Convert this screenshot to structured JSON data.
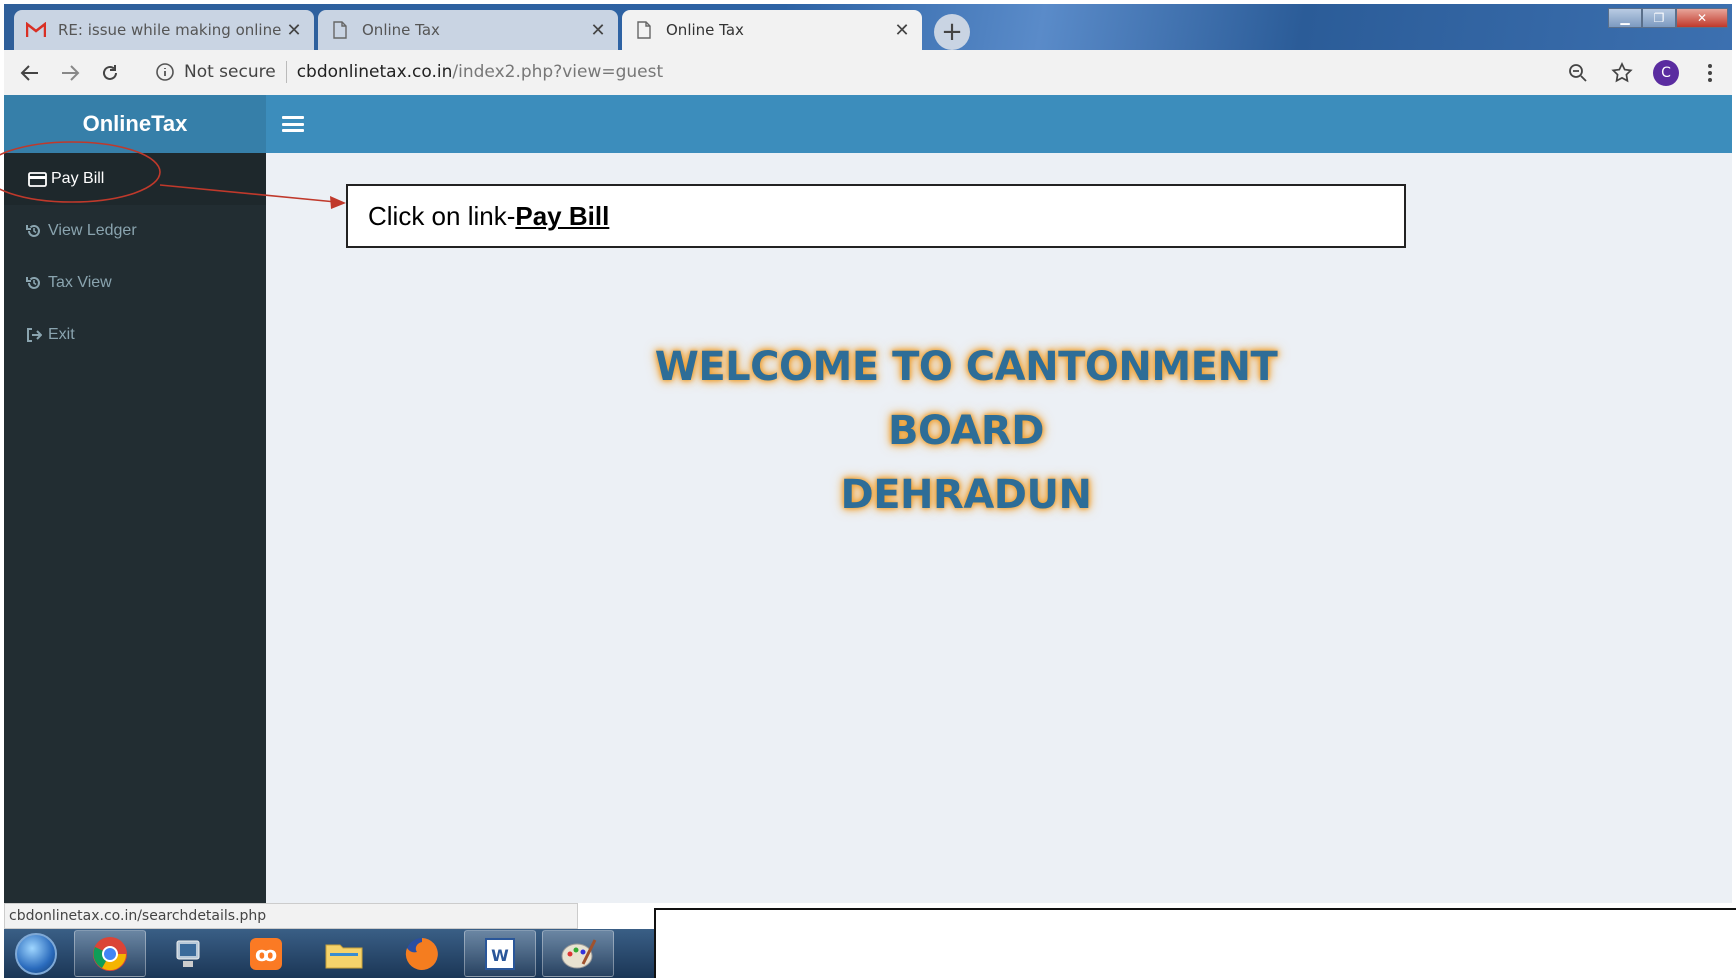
{
  "browser": {
    "tabs": [
      {
        "title": "RE: issue while making online pay",
        "icon": "gmail-icon",
        "active": false
      },
      {
        "title": "Online Tax",
        "icon": "page-icon",
        "active": false
      },
      {
        "title": "Online Tax",
        "icon": "page-icon",
        "active": true
      }
    ],
    "security_label": "Not secure",
    "url_host": "cbdonlinetax.co.in",
    "url_path": "/index2.php?view=guest",
    "profile_initial": "C"
  },
  "app": {
    "logo": "OnlineTax",
    "sidebar": {
      "items": [
        {
          "label": "Pay Bill",
          "icon": "credit-card-icon",
          "active": true
        },
        {
          "label": "View Ledger",
          "icon": "history-icon",
          "active": false
        },
        {
          "label": "Tax View",
          "icon": "history-icon",
          "active": false
        },
        {
          "label": "Exit",
          "icon": "sign-out-icon",
          "active": false
        }
      ]
    },
    "welcome_line1": "WELCOME TO CANTONMENT BOARD",
    "welcome_line2": "DEHRADUN"
  },
  "annotation": {
    "prefix": "Click on link-",
    "link": " Pay Bill",
    "color": "#c0392b"
  },
  "status_url": "cbdonlinetax.co.in/searchdetails.php",
  "taskbar": {
    "apps": [
      "chrome-icon",
      "network-icon",
      "xampp-icon",
      "explorer-icon",
      "firefox-icon",
      "word-icon",
      "paint-icon"
    ]
  }
}
